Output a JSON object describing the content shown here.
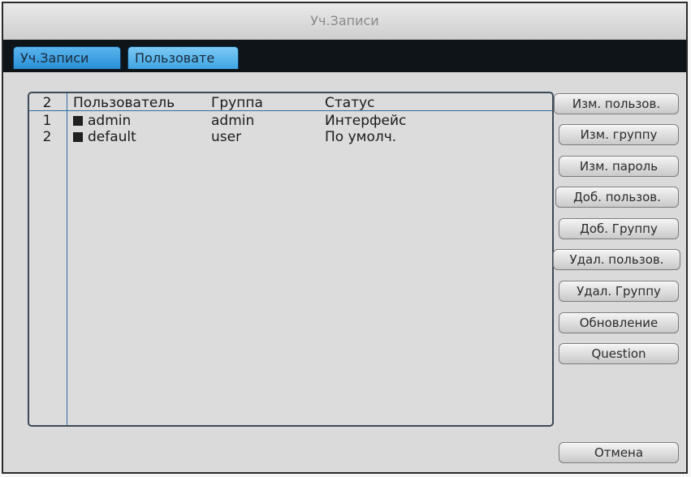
{
  "window": {
    "title": "Уч.Записи"
  },
  "tabs": [
    {
      "label": "Уч.Записи"
    },
    {
      "label": "Пользовате"
    }
  ],
  "table": {
    "count": "2",
    "headers": [
      "Пользователь",
      "Группа",
      "Статус"
    ],
    "rows": [
      {
        "index": "1",
        "user": "admin",
        "group": "admin",
        "status": "Интерфейс"
      },
      {
        "index": "2",
        "user": "default",
        "group": "user",
        "status": "По умолч."
      }
    ]
  },
  "buttons": {
    "edit_user": "Изм. пользов.",
    "edit_group": "Изм. группу",
    "edit_password": "Изм. пароль",
    "add_user": "Доб. пользов.",
    "add_group": "Доб. Группу",
    "delete_user": "Удал. пользов.",
    "delete_group": "Удал. Группу",
    "refresh": "Обновление",
    "question": "Question",
    "cancel": "Отмена"
  },
  "colors": {
    "tab_accent": "#2a8fd6",
    "tabstrip_bg": "#0f1418",
    "grid_line": "#2c6da6"
  }
}
